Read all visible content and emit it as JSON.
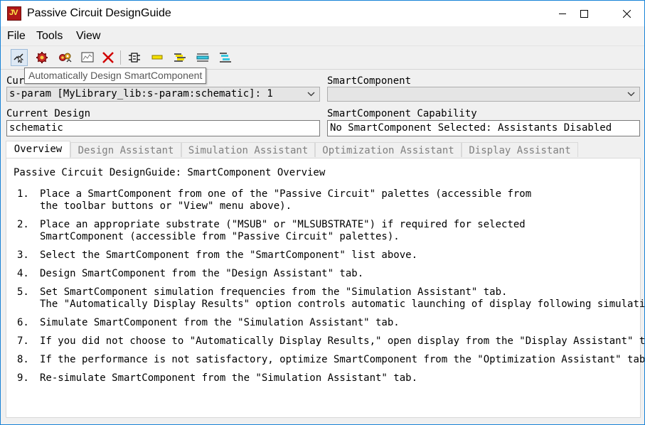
{
  "window": {
    "title": "Passive Circuit DesignGuide",
    "icon_text": "JV",
    "accent": "#1883d7"
  },
  "titlebar_buttons": [
    "minimize-icon",
    "maximize-icon",
    "close-icon"
  ],
  "menu": [
    "File",
    "Tools",
    "View"
  ],
  "toolbar": {
    "buttons": [
      "smart-design-icon",
      "gear-red-icon",
      "gear-multi-icon",
      "display-graph-icon",
      "delete-x-icon",
      "component-icon",
      "tline-icon",
      "coupled-line-icon",
      "stepped-line-icon",
      "multi-line-icon"
    ],
    "tooltip": "Automatically Design SmartComponent"
  },
  "form": {
    "current_schematic_label": "Current Schematic",
    "current_schematic_value": "s-param [MyLibrary_lib:s-param:schematic]: 1",
    "smartcomponent_label": "SmartComponent",
    "smartcomponent_value": "",
    "current_design_label": "Current Design",
    "current_design_value": "schematic",
    "capability_label": "SmartComponent Capability",
    "capability_value": "No SmartComponent Selected: Assistants Disabled"
  },
  "tabs": [
    "Overview",
    "Design Assistant",
    "Simulation Assistant",
    "Optimization Assistant",
    "Display Assistant"
  ],
  "overview": {
    "title": "Passive Circuit DesignGuide: SmartComponent Overview",
    "steps": [
      {
        "num": "1.",
        "lines": [
          "Place a SmartComponent from one of the \"Passive Circuit\" palettes (accessible from",
          "the toolbar buttons or \"View\" menu above)."
        ]
      },
      {
        "num": "2.",
        "lines": [
          "Place an appropriate substrate (\"MSUB\" or \"MLSUBSTRATE\") if required for selected",
          "SmartComponent (accessible from \"Passive Circuit\" palettes)."
        ]
      },
      {
        "num": "3.",
        "lines": [
          "Select the SmartComponent from the \"SmartComponent\" list above."
        ]
      },
      {
        "num": "4.",
        "lines": [
          "Design SmartComponent from the \"Design Assistant\" tab."
        ]
      },
      {
        "num": "5.",
        "lines": [
          "Set SmartComponent simulation frequencies from the \"Simulation Assistant\" tab.",
          "The \"Automatically Display Results\" option controls automatic launching of display following simulation."
        ]
      },
      {
        "num": "6.",
        "lines": [
          "Simulate SmartComponent from the \"Simulation Assistant\" tab."
        ]
      },
      {
        "num": "7.",
        "lines": [
          "If you did not choose to \"Automatically Display Results,\" open display from the \"Display Assistant\" tab."
        ]
      },
      {
        "num": "8.",
        "lines": [
          "If the performance is not satisfactory, optimize SmartComponent from the \"Optimization Assistant\" tab."
        ]
      },
      {
        "num": "9.",
        "lines": [
          "Re-simulate SmartComponent from the \"Simulation Assistant\" tab."
        ]
      }
    ]
  }
}
